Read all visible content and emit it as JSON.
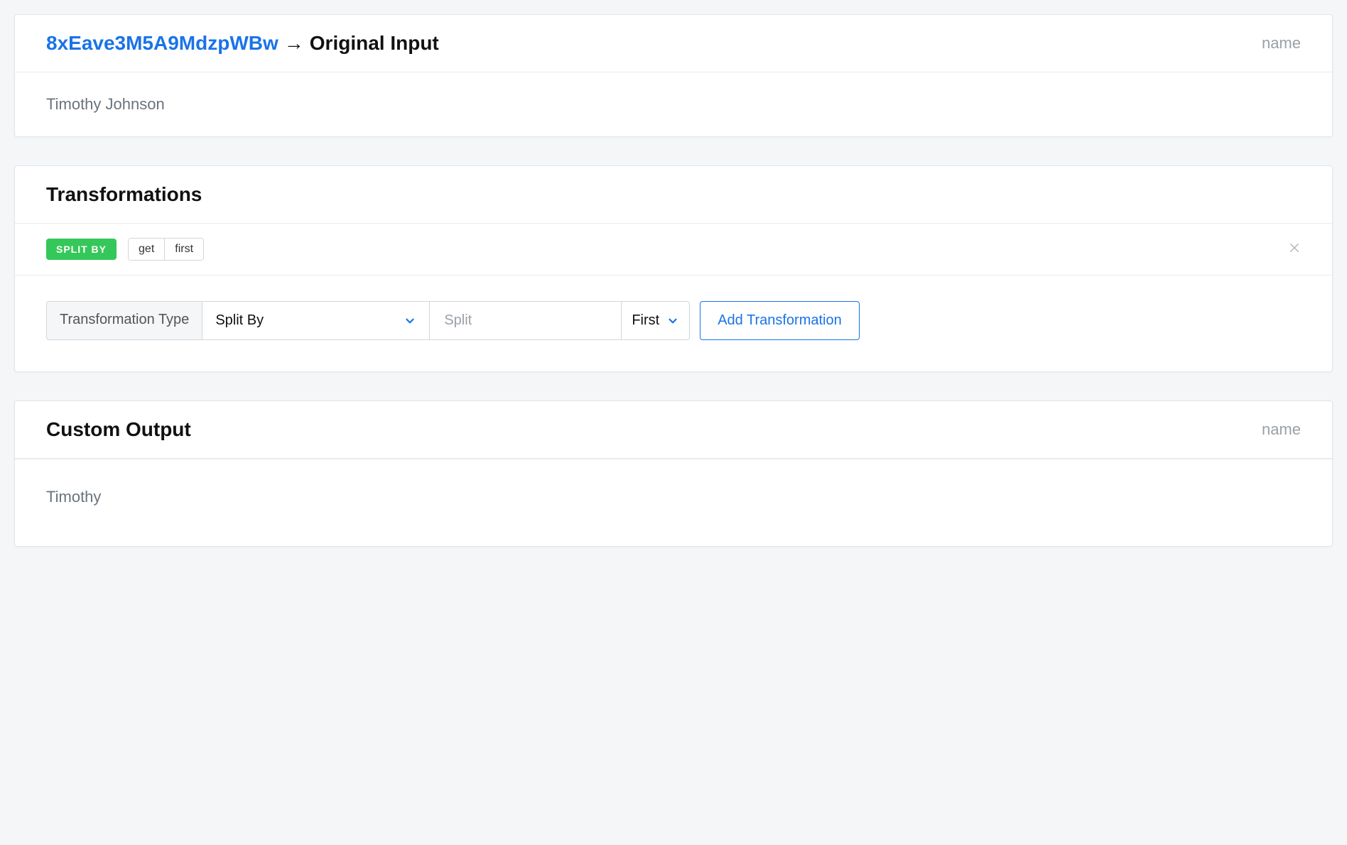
{
  "input": {
    "id": "8xEave3M5A9MdzpWBw",
    "arrow": "→",
    "label": "Original Input",
    "field": "name",
    "value": "Timothy Johnson"
  },
  "transformations": {
    "title": "Transformations",
    "active": {
      "tag": "SPLIT BY",
      "pill1": "get",
      "pill2": "first"
    },
    "builder": {
      "label": "Transformation Type",
      "type_value": "Split By",
      "split_placeholder": "Split",
      "position_value": "First",
      "add_button": "Add Transformation"
    }
  },
  "output": {
    "title": "Custom Output",
    "field": "name",
    "value": "Timothy"
  }
}
